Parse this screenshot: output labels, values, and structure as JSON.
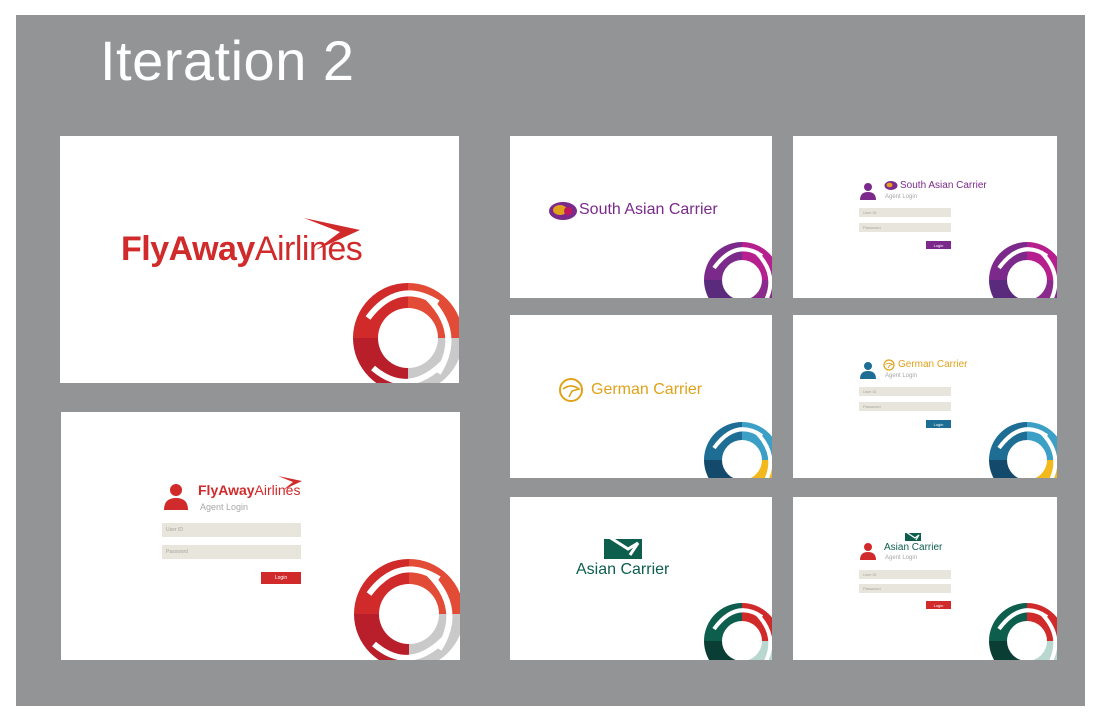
{
  "page": {
    "title": "Iteration 2"
  },
  "colors": {
    "flyaway": "#d02a2a",
    "south_asian": "#7b2a8c",
    "german": "#e0a21a",
    "german_button": "#1e6d94",
    "asian": "#0e5e4e",
    "asian_button": "#d02a2a",
    "field_bg": "#e7e5dc"
  },
  "flyaway": {
    "logo_bold": "FlyAway",
    "logo_thin": "Airlines",
    "login": {
      "logo_bold": "FlyAway",
      "logo_thin": "Airlines",
      "subtitle": "Agent Login",
      "user_field": "User ID",
      "password_field": "Password",
      "button": "Login"
    }
  },
  "south_asian": {
    "brand": "South Asian Carrier",
    "login": {
      "brand": "South Asian Carrier",
      "subtitle": "Agent Login",
      "user_field": "User ID",
      "password_field": "Password",
      "button": "Login"
    }
  },
  "german": {
    "brand": "German Carrier",
    "login": {
      "brand": "German Carrier",
      "subtitle": "Agent Login",
      "user_field": "User ID",
      "password_field": "Password",
      "button": "Login"
    }
  },
  "asian": {
    "brand": "Asian Carrier",
    "login": {
      "brand": "Asian Carrier",
      "subtitle": "Agent Login",
      "user_field": "User ID",
      "password_field": "Password",
      "button": "Login"
    }
  }
}
